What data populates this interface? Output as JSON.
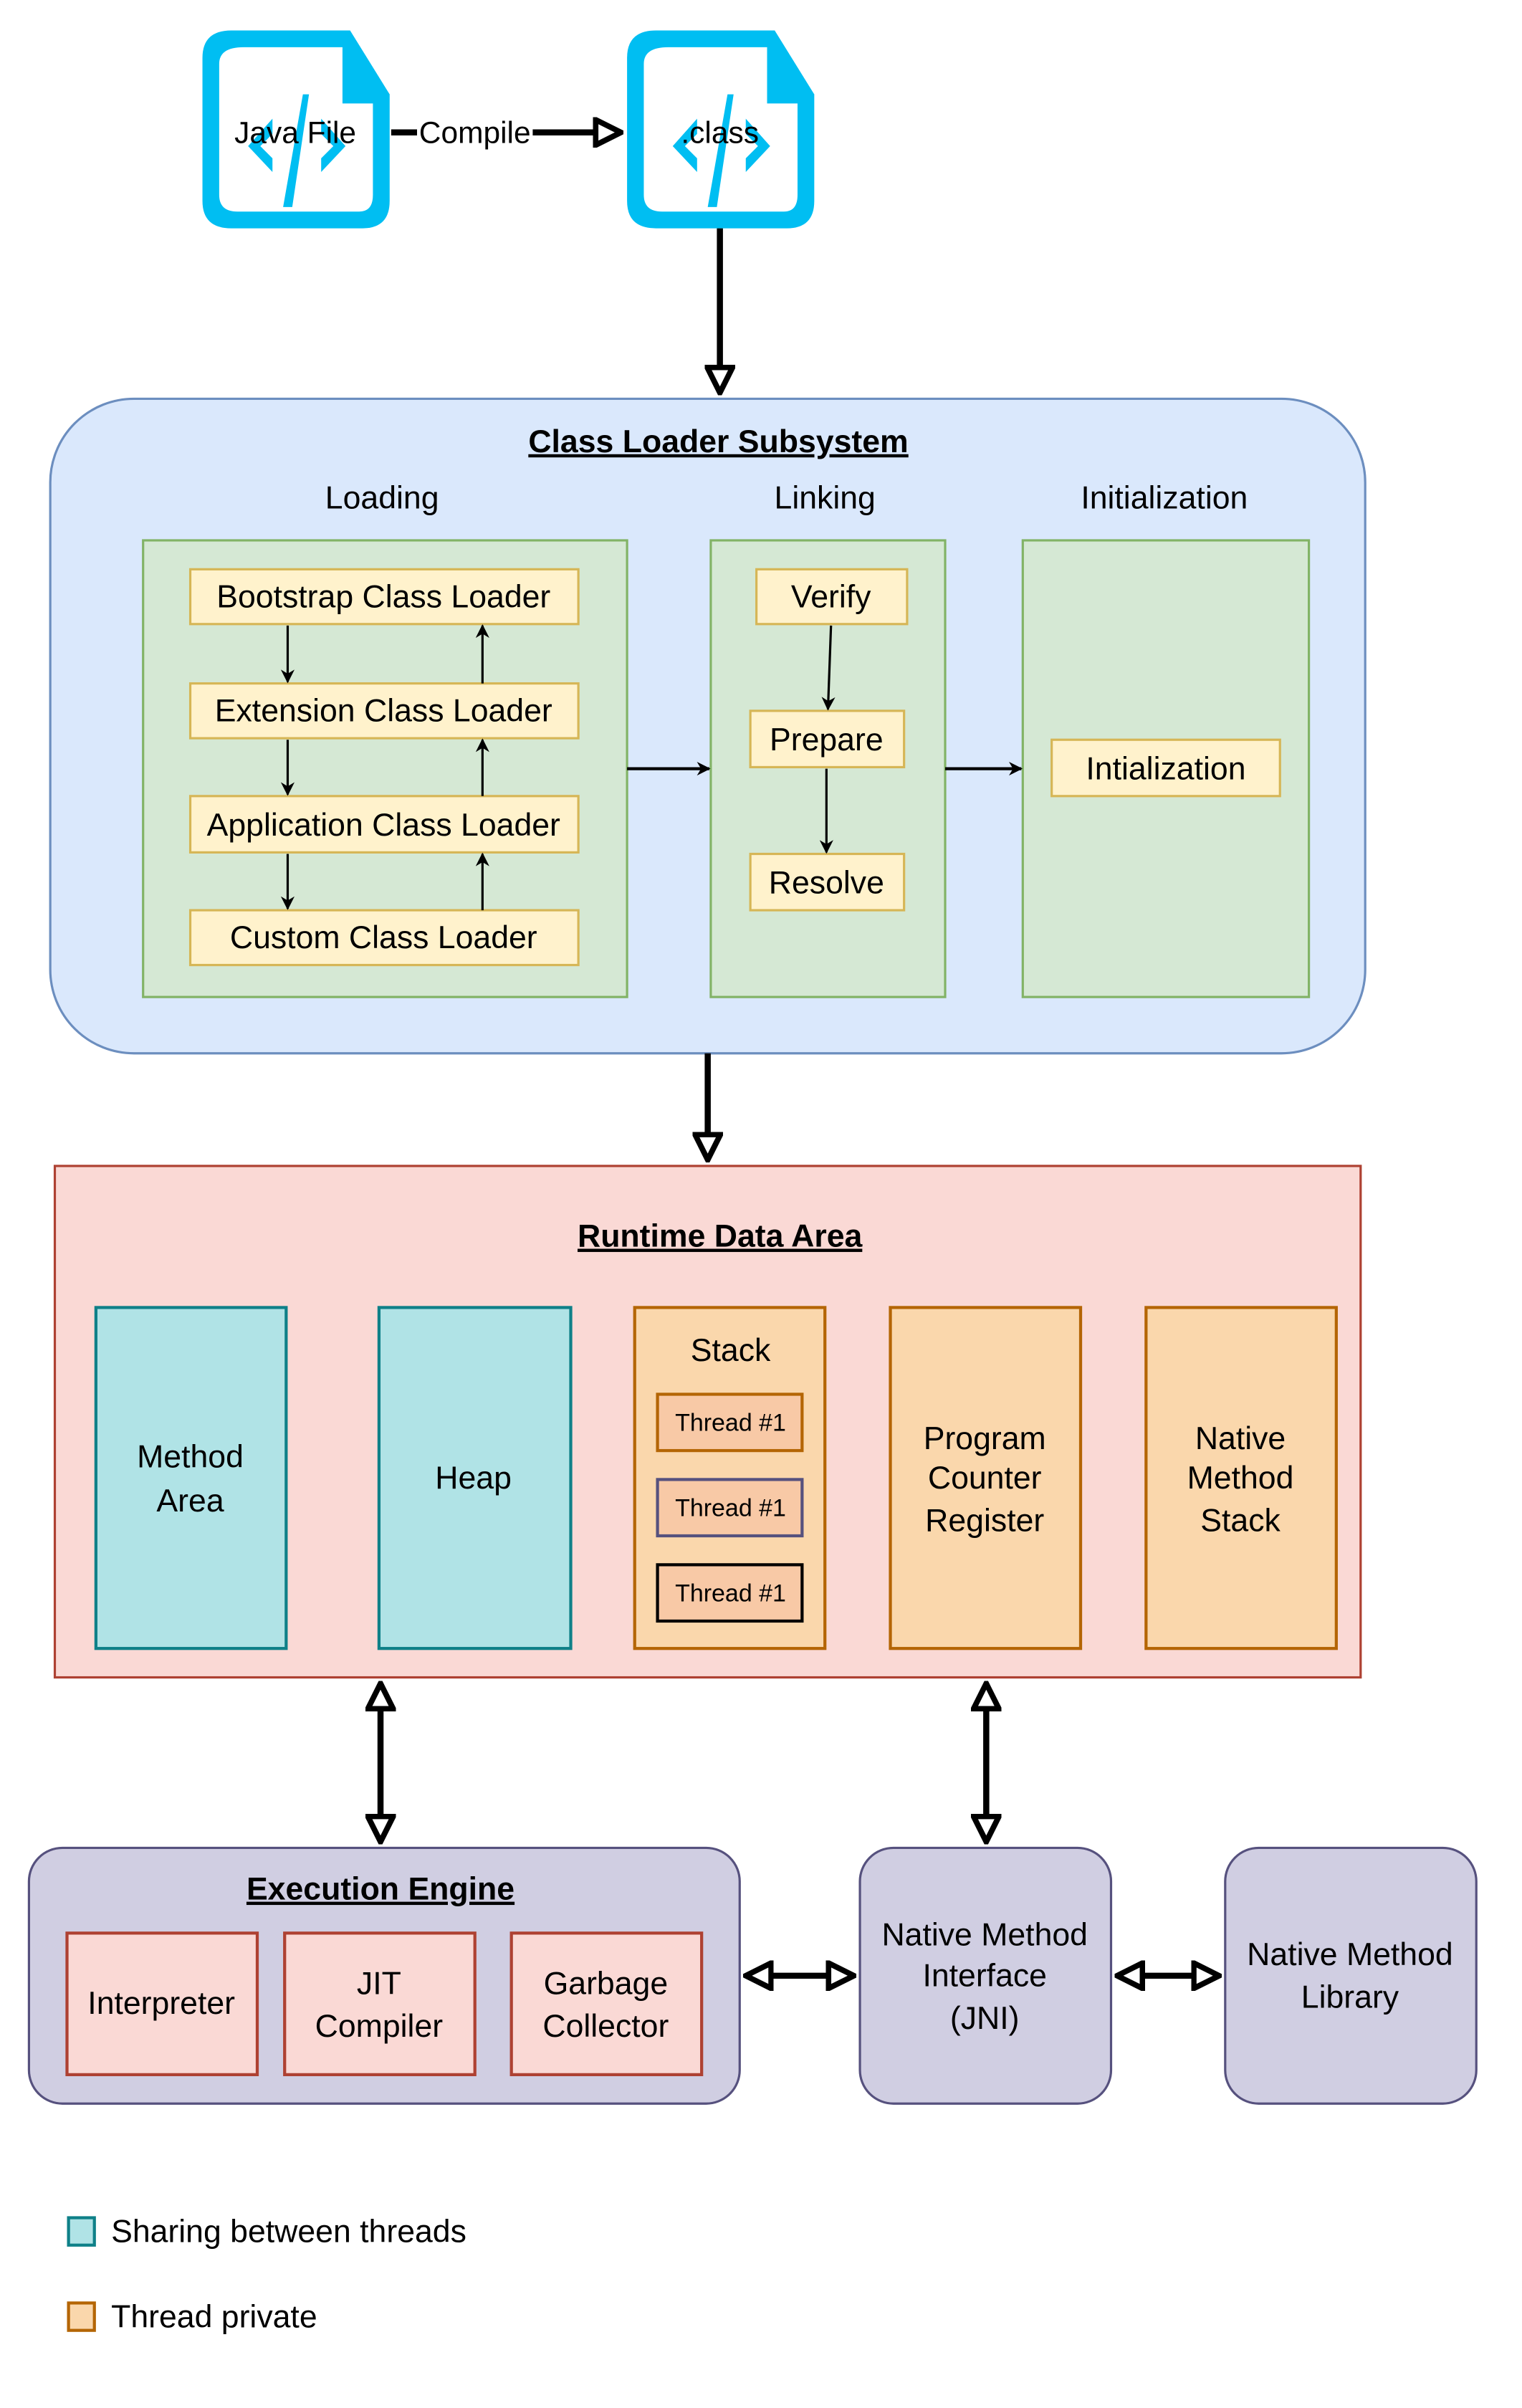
{
  "colors": {
    "file_icon": "#00BEF2",
    "class_loader_fill": "#DAE8FC",
    "class_loader_stroke": "#6C8EBF",
    "stage_fill": "#D5E8D4",
    "stage_stroke": "#82B366",
    "step_fill": "#FFF2CC",
    "step_stroke": "#D6B656",
    "runtime_fill": "#FAD9D5",
    "runtime_stroke": "#AE4132",
    "shared_fill": "#B0E3E6",
    "shared_stroke": "#0E8088",
    "private_fill": "#FAD7AC",
    "private_stroke": "#B46504",
    "thread_fill": "#F8C9A6",
    "engine_fill": "#D0CEE2",
    "engine_stroke": "#56517E"
  },
  "source": {
    "java_file": "Java File",
    "class_file": ".class",
    "compile_label": "Compile"
  },
  "class_loader": {
    "title": "Class Loader Subsystem",
    "stages": {
      "loading": "Loading",
      "linking": "Linking",
      "initialization": "Initialization"
    },
    "loaders": [
      "Bootstrap Class Loader",
      "Extension Class Loader",
      "Application Class Loader",
      "Custom Class Loader"
    ],
    "linking_steps": [
      "Verify",
      "Prepare",
      "Resolve"
    ],
    "init_step": "Intialization"
  },
  "runtime": {
    "title": "Runtime Data Area",
    "method_area": [
      "Method",
      "Area"
    ],
    "heap": "Heap",
    "stack": {
      "title": "Stack",
      "threads": [
        "Thread #1",
        "Thread #1",
        "Thread #1"
      ]
    },
    "pc_register": [
      "Program",
      "Counter",
      "Register"
    ],
    "native_stack": [
      "Native",
      "Method",
      "Stack"
    ]
  },
  "execution": {
    "title": "Execution Engine",
    "interpreter": "Interpreter",
    "jit": [
      "JIT",
      "Compiler"
    ],
    "gc": [
      "Garbage",
      "Collector"
    ]
  },
  "jni": [
    "Native Method",
    "Interface",
    "(JNI)"
  ],
  "native_library": [
    "Native Method",
    "Library"
  ],
  "legend": [
    {
      "label": "Sharing between threads",
      "kind": "shared"
    },
    {
      "label": "Thread private",
      "kind": "private"
    }
  ]
}
